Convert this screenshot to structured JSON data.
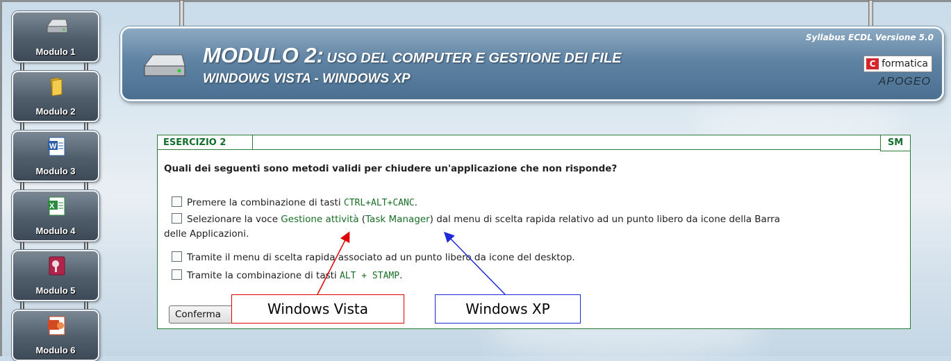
{
  "sidebar": {
    "modules": [
      {
        "label": "Modulo 1",
        "icon": "hard-drive-icon"
      },
      {
        "label": "Modulo 2",
        "icon": "folder-icon"
      },
      {
        "label": "Modulo 3",
        "icon": "word-icon"
      },
      {
        "label": "Modulo 4",
        "icon": "excel-icon"
      },
      {
        "label": "Modulo 5",
        "icon": "access-icon"
      },
      {
        "label": "Modulo 6",
        "icon": "powerpoint-icon"
      }
    ]
  },
  "header": {
    "title_big": "MODULO 2:",
    "title_rest": "USO DEL COMPUTER E GESTIONE DEI FILE",
    "subtitle": "WINDOWS VISTA - WINDOWS XP",
    "syllabus": "Syllabus ECDL Versione 5.0",
    "publisher1": "formatica",
    "publisher2": "APOGEO"
  },
  "exercise": {
    "tab_label": "ESERCIZIO 2",
    "tab_right": "SM",
    "question": "Quali dei seguenti sono metodi validi per chiudere un'applicazione che non risponde?",
    "options": [
      {
        "pre": "Premere la combinazione di tasti ",
        "code": "CTRL+ALT+CANC",
        "post": "."
      },
      {
        "pre": "Selezionare la voce ",
        "hl1": "Gestione attività",
        "mid1": " (",
        "hl2": "Task Manager",
        "post": ") dal menu di scelta rapida relativo ad un punto libero da icone della Barra",
        "cont": "delle Applicazioni."
      },
      {
        "pre": "Tramite il menu di scelta rapida associato ad un punto libero da icone del desktop."
      },
      {
        "pre": "Tramite la combinazione di tasti ",
        "code": "ALT + STAMP",
        "post": "."
      }
    ],
    "confirm_label": "Conferma"
  },
  "callouts": {
    "vista": "Windows Vista",
    "xp": "Windows XP"
  },
  "colors": {
    "accent_green": "#186e26",
    "callout_red": "#e00000",
    "callout_blue": "#1f2ad8",
    "banner_blue": "#5f83a3"
  }
}
